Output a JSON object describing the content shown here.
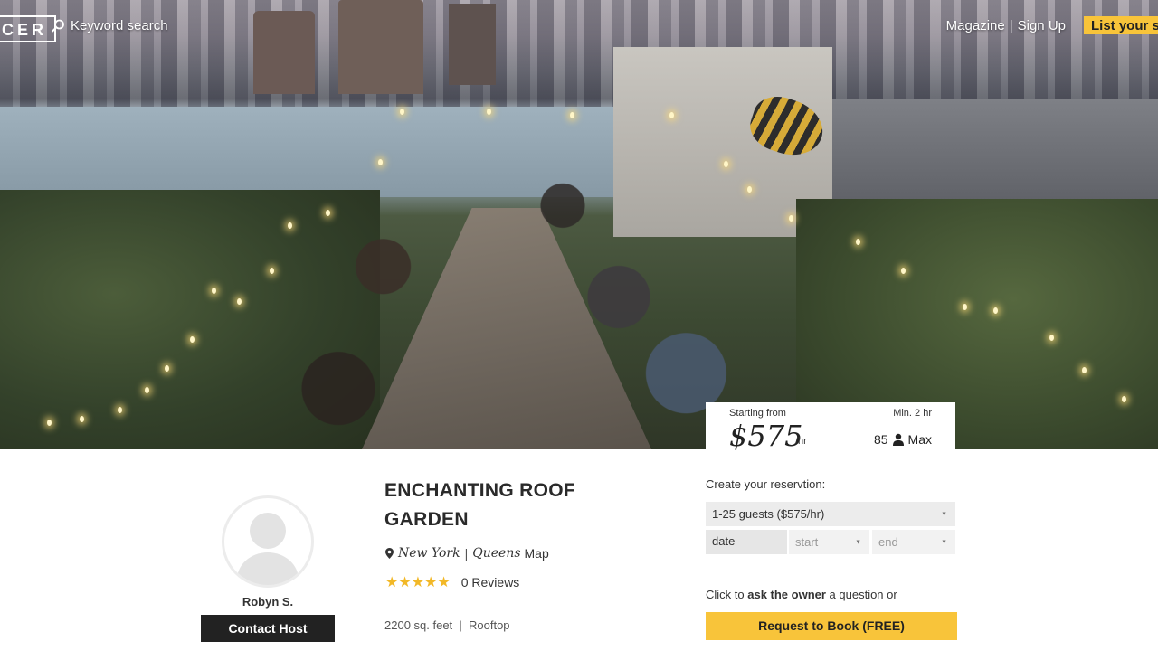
{
  "nav": {
    "logo": "CER",
    "search_label": "Keyword search",
    "magazine": "Magazine",
    "divider": "|",
    "sign_up": "Sign Up",
    "list_space": "List your sp"
  },
  "price_card": {
    "starting_from": "Starting from",
    "price": "$575",
    "unit": "/hr",
    "min": "Min. 2 hr",
    "max_count": "85",
    "max_label": "Max"
  },
  "host": {
    "name": "Robyn S.",
    "contact_label": "Contact Host"
  },
  "listing": {
    "title": "ENCHANTING ROOF GARDEN",
    "city": "New York",
    "loc_divider": "|",
    "borough": "Queens",
    "map_label": "Map",
    "stars": "★★★★★",
    "reviews": "0 Reviews",
    "details": "2200 sq. feet  |  Rooftop"
  },
  "reservation": {
    "heading": "Create your reservtion:",
    "guests_option": "1-25 guests ($575/hr)",
    "date_placeholder": "date",
    "start_placeholder": "start",
    "end_placeholder": "end",
    "ask_prefix": "Click to ",
    "ask_link": "ask the owner",
    "ask_suffix": " a question or",
    "request_label": "Request to Book (FREE)"
  },
  "colors": {
    "accent_yellow": "#f8c43a",
    "star_gold": "#f2b827",
    "dark_button": "#222222"
  }
}
